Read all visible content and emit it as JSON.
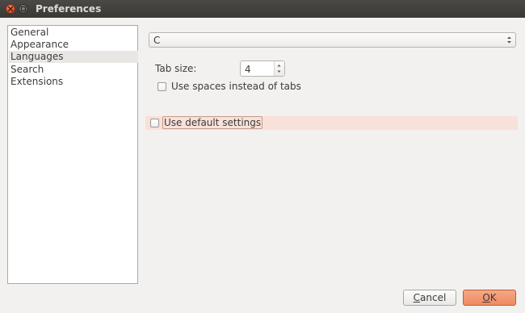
{
  "window": {
    "title": "Preferences",
    "close_icon": "close-icon",
    "maximize_icon": "maximize-icon"
  },
  "sidebar": {
    "items": [
      {
        "label": "General",
        "selected": false
      },
      {
        "label": "Appearance",
        "selected": false
      },
      {
        "label": "Languages",
        "selected": true
      },
      {
        "label": "Search",
        "selected": false
      },
      {
        "label": "Extensions",
        "selected": false
      }
    ]
  },
  "language": {
    "selected": "C"
  },
  "tab_size": {
    "label": "Tab size:",
    "value": "4"
  },
  "use_spaces": {
    "label": "Use spaces instead of tabs",
    "checked": false
  },
  "use_default": {
    "label": "Use default settings",
    "checked": false,
    "highlight_color": "#f8e1d9"
  },
  "buttons": {
    "cancel_mnemonic": "C",
    "cancel_rest": "ancel",
    "ok_mnemonic": "O",
    "ok_rest": "K",
    "accent": "#ef8a60"
  }
}
